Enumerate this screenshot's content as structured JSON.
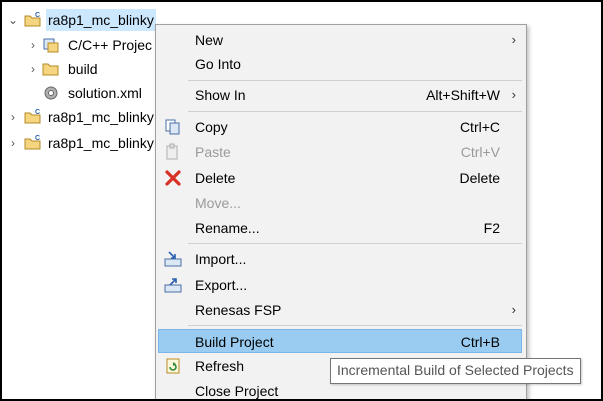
{
  "tree": {
    "items": [
      {
        "label": "ra8p1_mc_blinky",
        "icon": "c-project-folder-icon",
        "expanded": true
      },
      {
        "label": "C/C++ Projec",
        "icon": "c-includes-icon",
        "expanded": false
      },
      {
        "label": "build",
        "icon": "folder-icon",
        "expanded": false
      },
      {
        "label": "solution.xml",
        "icon": "gear-file-icon",
        "expanded": false
      },
      {
        "label": "ra8p1_mc_blinky",
        "icon": "c-project-folder-icon",
        "expanded": false
      },
      {
        "label": "ra8p1_mc_blinky",
        "icon": "c-project-folder-icon",
        "expanded": false
      }
    ]
  },
  "menu": {
    "items": [
      {
        "label": "New",
        "submenu": true
      },
      {
        "label": "Go Into"
      },
      {
        "label": "Show In",
        "shortcut": "Alt+Shift+W",
        "submenu": true
      },
      {
        "label": "Copy",
        "shortcut": "Ctrl+C",
        "icon": "copy-icon"
      },
      {
        "label": "Paste",
        "shortcut": "Ctrl+V",
        "icon": "paste-icon",
        "disabled": true
      },
      {
        "label": "Delete",
        "shortcut": "Delete",
        "icon": "delete-icon"
      },
      {
        "label": "Move...",
        "disabled": true
      },
      {
        "label": "Rename...",
        "shortcut": "F2"
      },
      {
        "label": "Import...",
        "icon": "import-icon"
      },
      {
        "label": "Export...",
        "icon": "export-icon"
      },
      {
        "label": "Renesas FSP",
        "submenu": true
      },
      {
        "label": "Build Project",
        "shortcut": "Ctrl+B",
        "highlighted": true
      },
      {
        "label": "Refresh",
        "icon": "refresh-icon"
      },
      {
        "label": "Close Project"
      }
    ],
    "submenu_arrow": "›"
  },
  "tooltip": {
    "text": "Incremental Build of Selected Projects"
  },
  "colors": {
    "highlight": "#99ccf0",
    "selection": "#cce8ff",
    "menu_bg": "#f2f2f2"
  }
}
